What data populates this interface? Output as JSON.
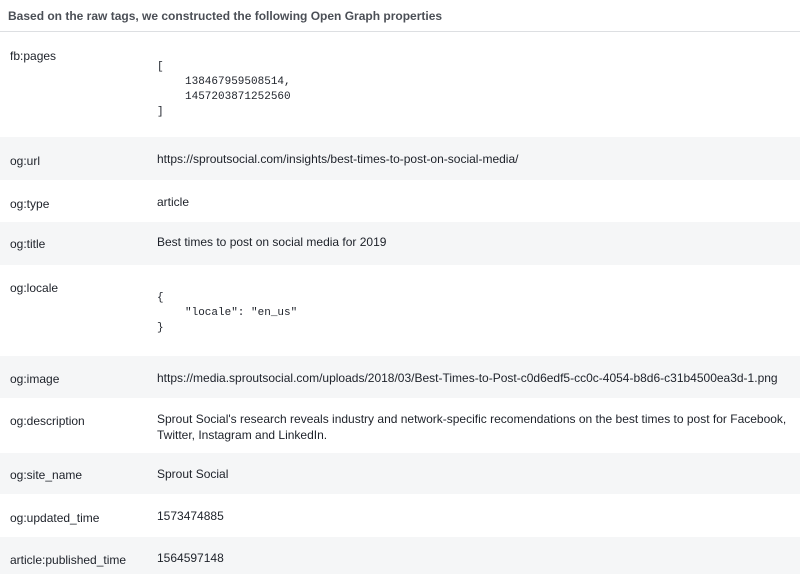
{
  "header": {
    "title": "Based on the raw tags, we constructed the following Open Graph properties"
  },
  "properties": [
    {
      "key": "fb:pages",
      "open": "[",
      "items": [
        "138467959508514,",
        "1457203871252560"
      ],
      "close": "]"
    },
    {
      "key": "og:url",
      "value": "https://sproutsocial.com/insights/best-times-to-post-on-social-media/"
    },
    {
      "key": "og:type",
      "value": "article"
    },
    {
      "key": "og:title",
      "value": "Best times to post on social media for 2019"
    },
    {
      "key": "og:locale",
      "open": "{",
      "items": [
        "\"locale\": \"en_us\""
      ],
      "close": "}"
    },
    {
      "key": "og:image",
      "value": "https://media.sproutsocial.com/uploads/2018/03/Best-Times-to-Post-c0d6edf5-cc0c-4054-b8d6-c31b4500ea3d-1.png"
    },
    {
      "key": "og:description",
      "value": "Sprout Social's research reveals industry and network-specific recomendations on the best times to post for Facebook, Twitter, Instagram and LinkedIn."
    },
    {
      "key": "og:site_name",
      "value": "Sprout Social"
    },
    {
      "key": "og:updated_time",
      "value": "1573474885"
    },
    {
      "key": "article:published_time",
      "value": "1564597148"
    }
  ]
}
